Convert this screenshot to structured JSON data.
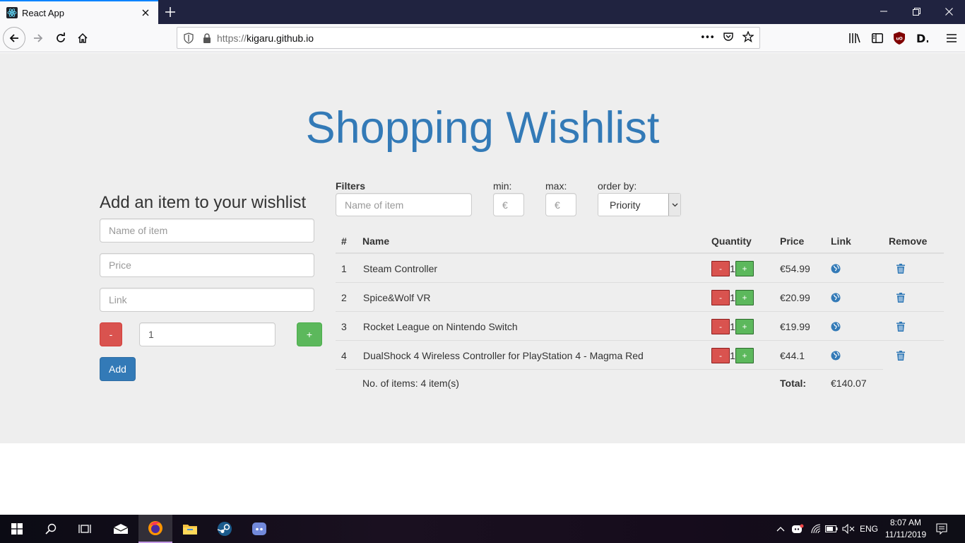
{
  "browser": {
    "tab_title": "React App",
    "url_protocol": "https://",
    "url_host": "kigaru.github.io",
    "url_more": "•••"
  },
  "page": {
    "title": "Shopping Wishlist"
  },
  "add_form": {
    "heading": "Add an item to your wishlist",
    "name_placeholder": "Name of item",
    "price_placeholder": "Price",
    "link_placeholder": "Link",
    "minus_label": "-",
    "quantity_value": "1",
    "plus_label": "+",
    "add_label": "Add"
  },
  "filters": {
    "label": "Filters",
    "name_placeholder": "Name of item",
    "min_label": "min:",
    "min_placeholder": "€",
    "max_label": "max:",
    "max_placeholder": "€",
    "order_label": "order by:",
    "order_selected": "Priority"
  },
  "table": {
    "headers": {
      "num": "#",
      "name": "Name",
      "quantity": "Quantity",
      "price": "Price",
      "link": "Link",
      "remove": "Remove"
    },
    "rows": [
      {
        "num": "1",
        "name": "Steam Controller",
        "qty": "1",
        "price": "€54.99"
      },
      {
        "num": "2",
        "name": "Spice&Wolf VR",
        "qty": "1",
        "price": "€20.99"
      },
      {
        "num": "3",
        "name": "Rocket League on Nintendo Switch",
        "qty": "1",
        "price": "€19.99"
      },
      {
        "num": "4",
        "name": "DualShock 4 Wireless Controller for PlayStation 4 - Magma Red",
        "qty": "1",
        "price": "€44.1"
      }
    ],
    "qty_minus": "-",
    "qty_plus": "+",
    "footer_count": "No. of items: 4 item(s)",
    "footer_total_label": "Total:",
    "footer_total_value": "€140.07"
  },
  "taskbar": {
    "lang": "ENG",
    "time": "8:07 AM",
    "date": "11/11/2019"
  },
  "colors": {
    "brand_blue": "#337ab7",
    "danger": "#d9534f",
    "success": "#5cb85c",
    "page_bg": "#eeeeee"
  }
}
